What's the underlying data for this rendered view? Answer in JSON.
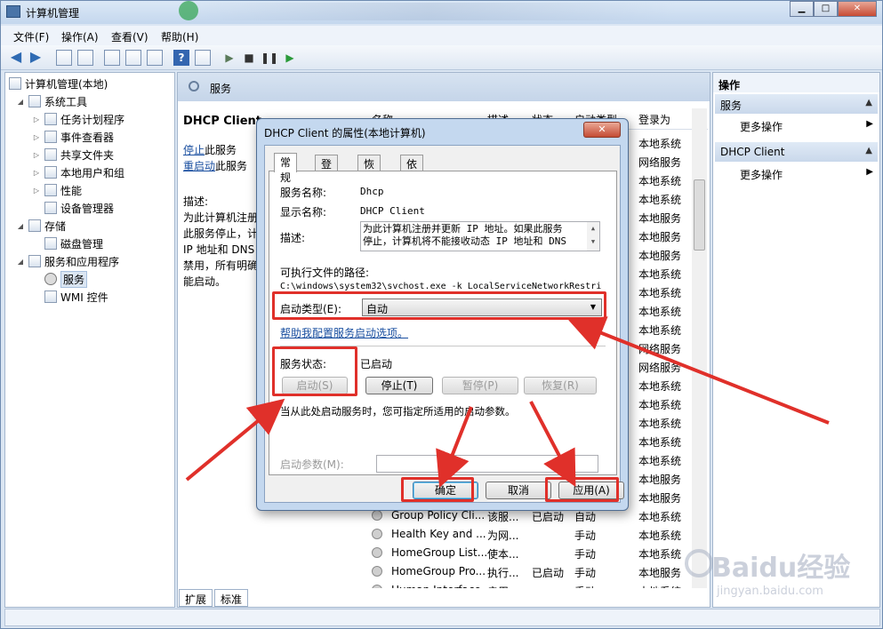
{
  "window": {
    "title": "计算机管理",
    "min": "▁",
    "max": "□",
    "close": "✕"
  },
  "menu": [
    "文件(F)",
    "操作(A)",
    "查看(V)",
    "帮助(H)"
  ],
  "toolbar": {
    "help": "?"
  },
  "tree": {
    "root": "计算机管理(本地)",
    "system_tools": "系统工具",
    "task_scheduler": "任务计划程序",
    "event_viewer": "事件查看器",
    "shared_folders": "共享文件夹",
    "local_users": "本地用户和组",
    "performance": "性能",
    "device_manager": "设备管理器",
    "storage": "存储",
    "disk_management": "磁盘管理",
    "services_apps": "服务和应用程序",
    "services": "服务",
    "wmi": "WMI 控件"
  },
  "center": {
    "header": "服务",
    "selected_service": "DHCP Client",
    "stop_link": "停止",
    "stop_suffix": "此服务",
    "restart_link": "重启动",
    "restart_suffix": "此服务",
    "desc_label": "描述:",
    "desc_lines": [
      "为此计算机注册",
      "此服务停止，计",
      "IP 地址和 DNS",
      "禁用，所有明确",
      "能启动。"
    ],
    "columns": [
      "名称",
      "描述",
      "状态",
      "启动类型",
      "登录为"
    ],
    "rows": [
      {
        "logon": "本地系统"
      },
      {
        "logon": "网络服务"
      },
      {
        "logon": "本地系统"
      },
      {
        "logon": "本地系统"
      },
      {
        "logon": "本地服务"
      },
      {
        "logon": "本地服务"
      },
      {
        "logon": "本地服务"
      },
      {
        "logon": "本地系统"
      },
      {
        "logon": "本地系统"
      },
      {
        "logon": "本地系统"
      },
      {
        "logon": "本地系统"
      },
      {
        "logon": "网络服务"
      },
      {
        "logon": "网络服务"
      },
      {
        "logon": "本地系统"
      },
      {
        "logon": "本地系统"
      },
      {
        "logon": "本地系统"
      },
      {
        "logon": "本地系统"
      },
      {
        "logon": "本地系统"
      },
      {
        "logon": "本地服务"
      },
      {
        "logon": "本地服务"
      },
      {
        "name": "Group Policy Cli...",
        "desc": "该服...",
        "status": "已启动",
        "startup": "自动",
        "logon": "本地系统"
      },
      {
        "name": "Health Key and ...",
        "desc": "为网...",
        "status": "",
        "startup": "手动",
        "logon": "本地系统"
      },
      {
        "name": "HomeGroup List...",
        "desc": "使本...",
        "status": "",
        "startup": "手动",
        "logon": "本地系统"
      },
      {
        "name": "HomeGroup Pro...",
        "desc": "执行...",
        "status": "已启动",
        "startup": "手动",
        "logon": "本地服务"
      },
      {
        "name": "Human Interface...",
        "desc": "启用...",
        "status": "",
        "startup": "手动",
        "logon": "本地系统"
      }
    ],
    "tabs": [
      "扩展",
      "标准"
    ]
  },
  "actions": {
    "title": "操作",
    "section1": "服务",
    "section1_item": "更多操作",
    "section2": "DHCP Client",
    "section2_item": "更多操作"
  },
  "dialog": {
    "title": "DHCP Client 的属性(本地计算机)",
    "tabs": [
      "常规",
      "登录",
      "恢复",
      "依存关系"
    ],
    "service_name_label": "服务名称:",
    "service_name": "Dhcp",
    "display_name_label": "显示名称:",
    "display_name": "DHCP Client",
    "description_label": "描述:",
    "description_line1": "为此计算机注册并更新 IP 地址。如果此服务",
    "description_line2": "停止，计算机将不能接收动态 IP 地址和 DNS",
    "exe_path_label": "可执行文件的路径:",
    "exe_path": "C:\\windows\\system32\\svchost.exe -k LocalServiceNetworkRestri",
    "startup_type_label": "启动类型(E):",
    "startup_type": "自动",
    "help_link": "帮助我配置服务启动选项。",
    "status_label": "服务状态:",
    "status_value": "已启动",
    "btn_start": "启动(S)",
    "btn_stop": "停止(T)",
    "btn_pause": "暂停(P)",
    "btn_resume": "恢复(R)",
    "hint": "当从此处启动服务时，您可指定所适用的启动参数。",
    "param_label": "启动参数(M):",
    "btn_ok": "确定",
    "btn_cancel": "取消",
    "btn_apply": "应用(A)"
  },
  "colors": {
    "highlight": "#e0302a",
    "link": "#1a4fa0"
  },
  "watermark": {
    "brand": "Baidu经验",
    "url": "jingyan.baidu.com"
  }
}
